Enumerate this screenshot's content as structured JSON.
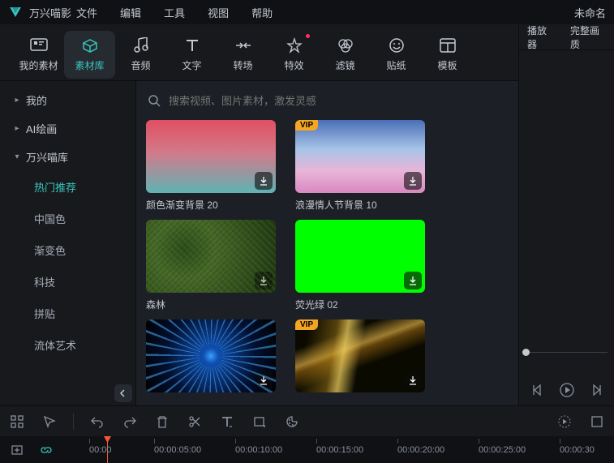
{
  "app_name": "万兴喵影",
  "doc_title": "未命名",
  "menu": [
    "文件",
    "编辑",
    "工具",
    "视图",
    "帮助"
  ],
  "tabs": [
    {
      "label": "我的素材"
    },
    {
      "label": "素材库"
    },
    {
      "label": "音频"
    },
    {
      "label": "文字"
    },
    {
      "label": "转场"
    },
    {
      "label": "特效"
    },
    {
      "label": "滤镜"
    },
    {
      "label": "贴纸"
    },
    {
      "label": "模板"
    }
  ],
  "sidebar": {
    "my": "我的",
    "ai": "AI绘画",
    "lib": "万兴喵库",
    "children": [
      "热门推荐",
      "中国色",
      "渐变色",
      "科技",
      "拼贴",
      "流体艺术"
    ]
  },
  "search_placeholder": "搜索视频、图片素材，激发灵感",
  "cards": [
    {
      "title": "颜色渐变背景 20",
      "thumb": "gradient1",
      "vip": false
    },
    {
      "title": "浪漫情人节背景 10",
      "thumb": "romance",
      "vip": true
    },
    {
      "title": "森林",
      "thumb": "forest",
      "vip": false
    },
    {
      "title": "荧光绿 02",
      "thumb": "green",
      "vip": false
    },
    {
      "title": "",
      "thumb": "burst",
      "vip": false
    },
    {
      "title": "",
      "thumb": "gold",
      "vip": true
    }
  ],
  "player_tabs": [
    "播放器",
    "完整画质"
  ],
  "timeline": {
    "current": "00:00",
    "marks": [
      "00:00:05:00",
      "00:00:10:00",
      "00:00:15:00",
      "00:00:20:00",
      "00:00:25:00",
      "00:00:30"
    ]
  }
}
